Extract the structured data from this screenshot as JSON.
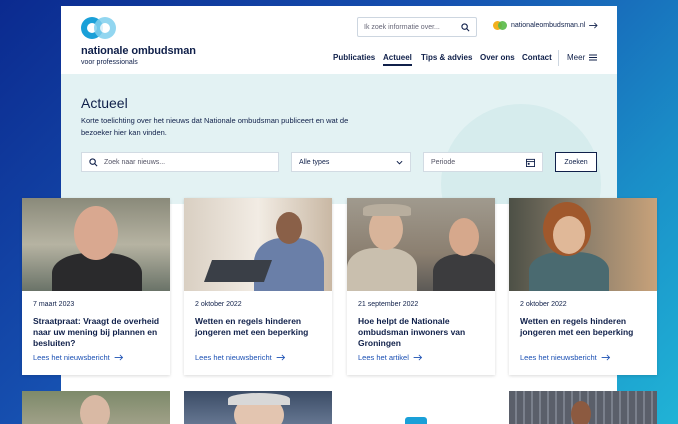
{
  "header": {
    "logo_title": "nationale ombudsman",
    "logo_subtitle": "voor professionals",
    "search_placeholder": "Ik zoek informatie over...",
    "external_link": "nationaleombudsman.nl",
    "nav": [
      {
        "label": "Publicaties",
        "active": false
      },
      {
        "label": "Actueel",
        "active": true
      },
      {
        "label": "Tips & advies",
        "active": false
      },
      {
        "label": "Over ons",
        "active": false
      },
      {
        "label": "Contact",
        "active": false
      }
    ],
    "meer_label": "Meer"
  },
  "hero": {
    "title": "Actueel",
    "intro": "Korte toelichting over het nieuws dat Nationale ombudsman publiceert en wat de bezoeker hier kan vinden.",
    "search_placeholder": "Zoek naar nieuws...",
    "type_select": "Alle types",
    "period_placeholder": "Periode",
    "search_button": "Zoeken"
  },
  "cards": [
    {
      "date": "7 maart 2023",
      "title": "Straatpraat: Vraagt de overheid naar uw mening bij plannen en besluiten?",
      "link": "Lees het nieuwsbericht"
    },
    {
      "date": "2 oktober 2022",
      "title": "Wetten en regels hinderen jongeren met een beperking",
      "link": "Lees het nieuwsbericht"
    },
    {
      "date": "21 september 2022",
      "title": "Hoe helpt de Nationale ombudsman inwoners van Groningen",
      "link": "Lees het artikel"
    },
    {
      "date": "2 oktober 2022",
      "title": "Wetten en regels hinderen jongeren met een beperking",
      "link": "Lees het nieuwsbericht"
    }
  ],
  "colors": {
    "navy": "#10204a",
    "accent": "#1a4fb3",
    "hero_bg": "#e3f2f3"
  }
}
